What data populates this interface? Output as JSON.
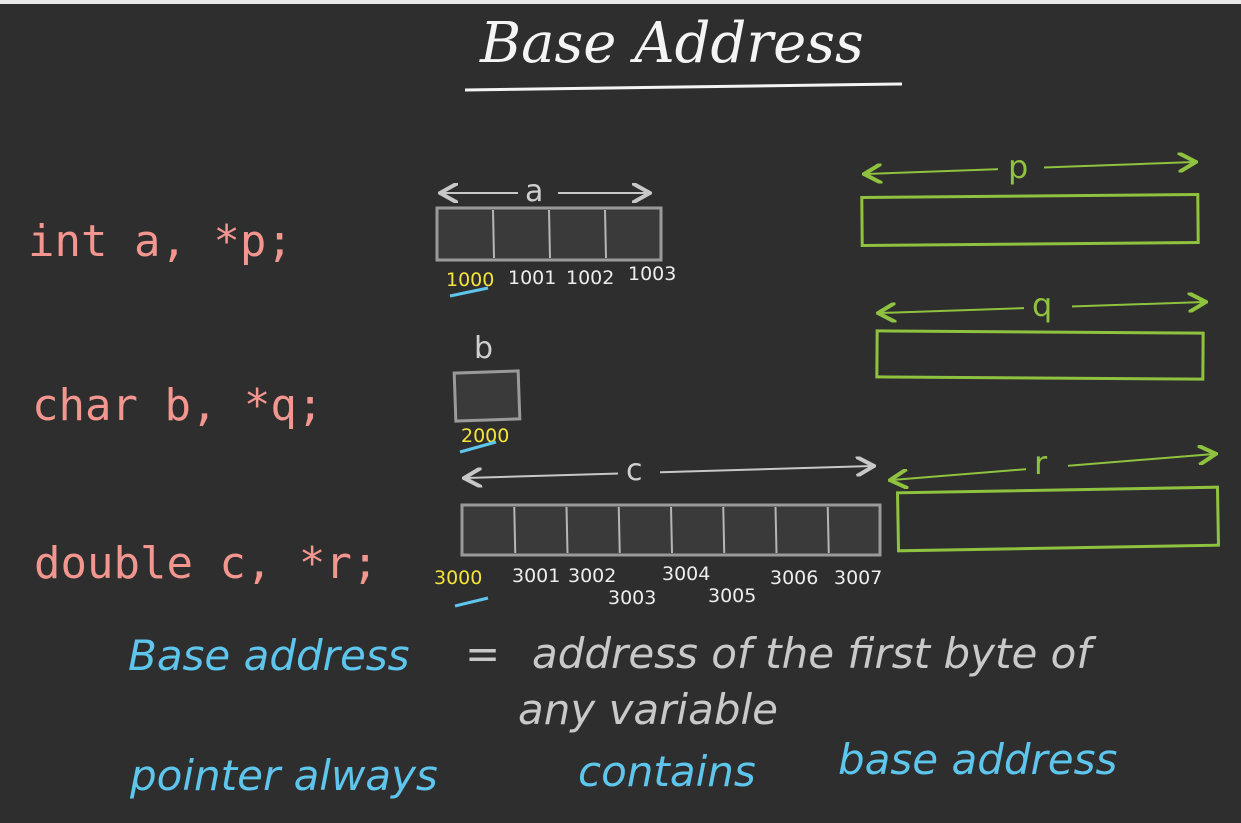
{
  "title": "Base Address",
  "declarations": {
    "int_line": "int a, *p;",
    "char_line": "char b, *q;",
    "double_line": "double c, *r;"
  },
  "variables": {
    "a": {
      "label": "a",
      "bytes": 4,
      "addresses": [
        "1000",
        "1001",
        "1002",
        "1003"
      ]
    },
    "b": {
      "label": "b",
      "bytes": 1,
      "addresses": [
        "2000"
      ]
    },
    "c": {
      "label": "c",
      "bytes": 8,
      "addresses": [
        "3000",
        "3001",
        "3002",
        "3003",
        "3004",
        "3005",
        "3006",
        "3007"
      ]
    }
  },
  "pointers": {
    "p": "p",
    "q": "q",
    "r": "r"
  },
  "definition": {
    "term": "Base address",
    "equals": "=",
    "rest_line1": "address of the first byte of",
    "rest_line2": "any variable"
  },
  "statement": {
    "part1": "pointer always",
    "part2": "contains",
    "part3": "base address"
  },
  "colors": {
    "background": "#2e2e2e",
    "declaration": "#f2968f",
    "memory_box": "#9a9a9a",
    "pointer_box": "#8fc23e",
    "address_text": "#f4e43a",
    "highlight": "#5ec6ec"
  }
}
